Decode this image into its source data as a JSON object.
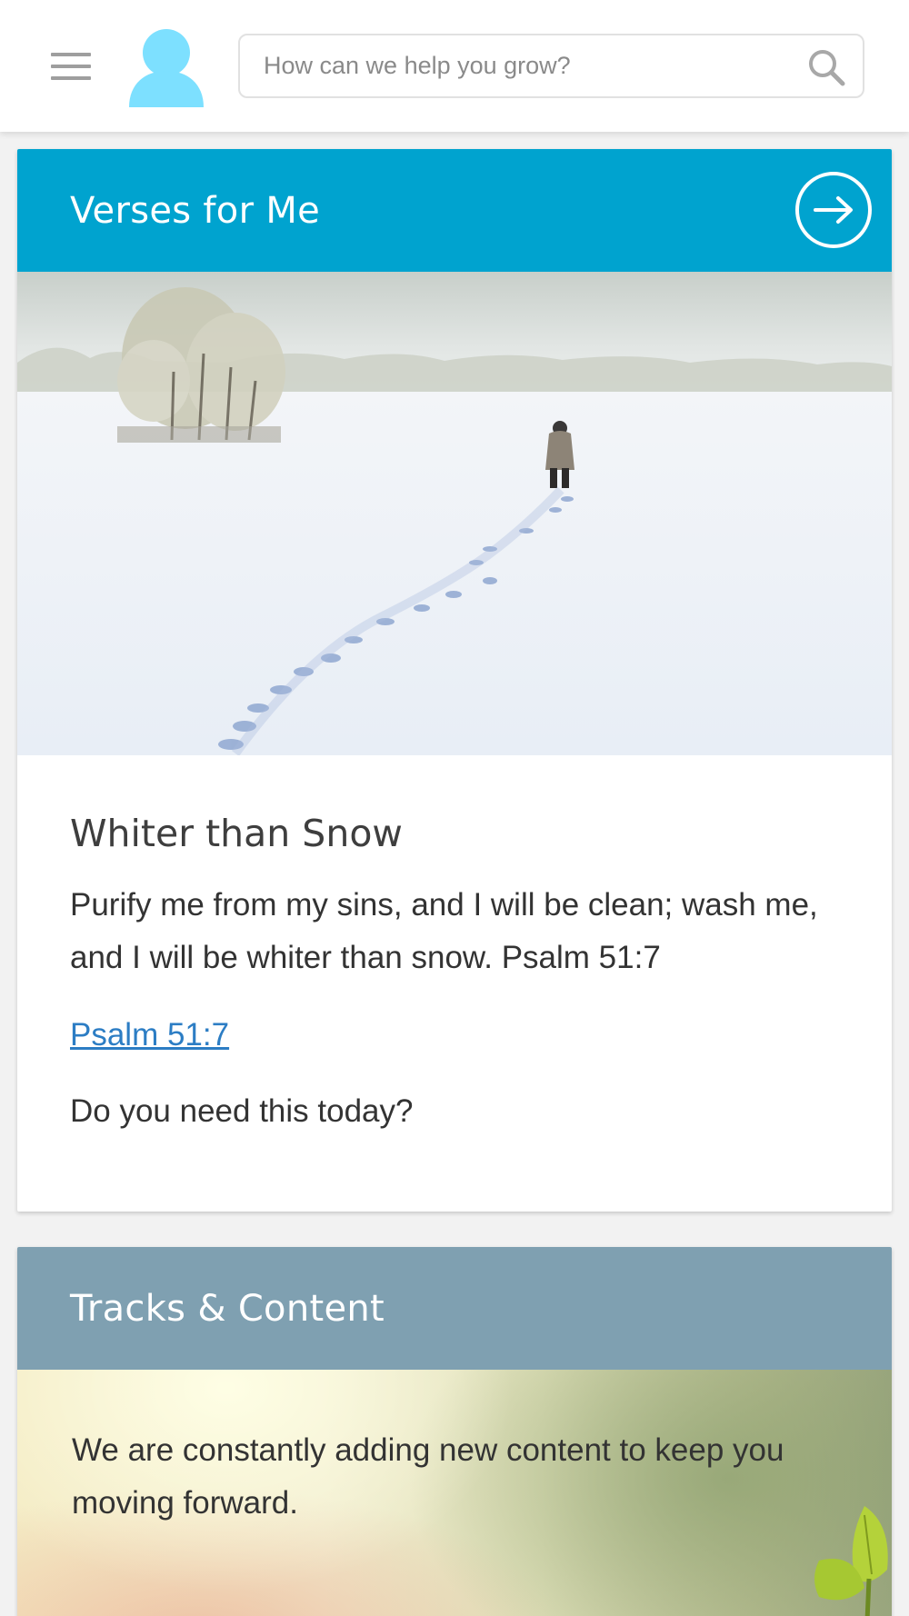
{
  "colors": {
    "accent": "#00a3cf",
    "avatar": "#7de0ff",
    "tracks_header": "#7fa0b1",
    "link": "#2c7dc4"
  },
  "header": {
    "menu_icon": "hamburger-menu-icon",
    "avatar_icon": "user-avatar-icon",
    "search": {
      "placeholder": "How can we help you grow?",
      "value": "",
      "icon": "search-icon"
    }
  },
  "verses_card": {
    "title": "Verses for Me",
    "arrow_icon": "arrow-right-circle-icon",
    "image": "snowy field with person walking and footprints",
    "verse_title": "Whiter than Snow",
    "verse_text": "Purify me from my sins, and I will be clean; wash me, and I will be whiter than snow. Psalm 51:7",
    "reference_link": "Psalm 51:7",
    "question": "Do you need this today?"
  },
  "tracks_card": {
    "title": "Tracks & Content",
    "description": "We are constantly adding new content to keep you moving forward."
  }
}
